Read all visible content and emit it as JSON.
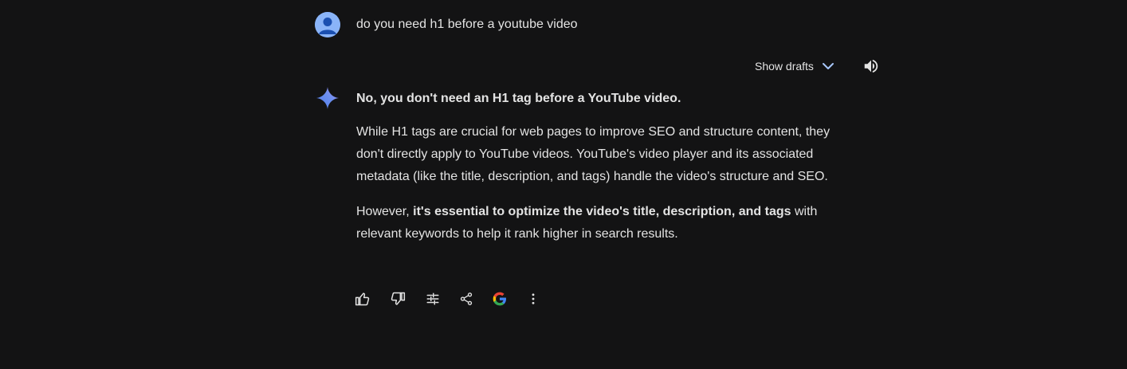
{
  "user": {
    "query": "do you need h1 before a youtube video",
    "avatar_icon": "user-avatar-icon"
  },
  "toolbar": {
    "show_drafts_label": "Show drafts",
    "chevron_icon": "chevron-down-icon",
    "speaker_icon": "volume-icon"
  },
  "response": {
    "icon": "gemini-spark-icon",
    "heading": "No, you don't need an H1 tag before a YouTube video.",
    "paragraph1": "While H1 tags are crucial for web pages to improve SEO and structure content, they don't directly apply to YouTube videos. YouTube's video player and its associated metadata (like the title, description, and tags) handle the video's structure and SEO.",
    "paragraph2_before": "However, ",
    "paragraph2_bold": "it's essential to optimize the video's title, description, and tags",
    "paragraph2_after": " with relevant keywords to help it rank higher in search results."
  },
  "actions": [
    {
      "name": "thumbs-up-icon"
    },
    {
      "name": "thumbs-down-icon"
    },
    {
      "name": "modify-response-icon"
    },
    {
      "name": "share-icon"
    },
    {
      "name": "google-search-icon"
    },
    {
      "name": "more-options-icon"
    }
  ],
  "colors": {
    "background": "#131314",
    "text": "#e3e3e3",
    "accent": "#a8c7fa"
  }
}
